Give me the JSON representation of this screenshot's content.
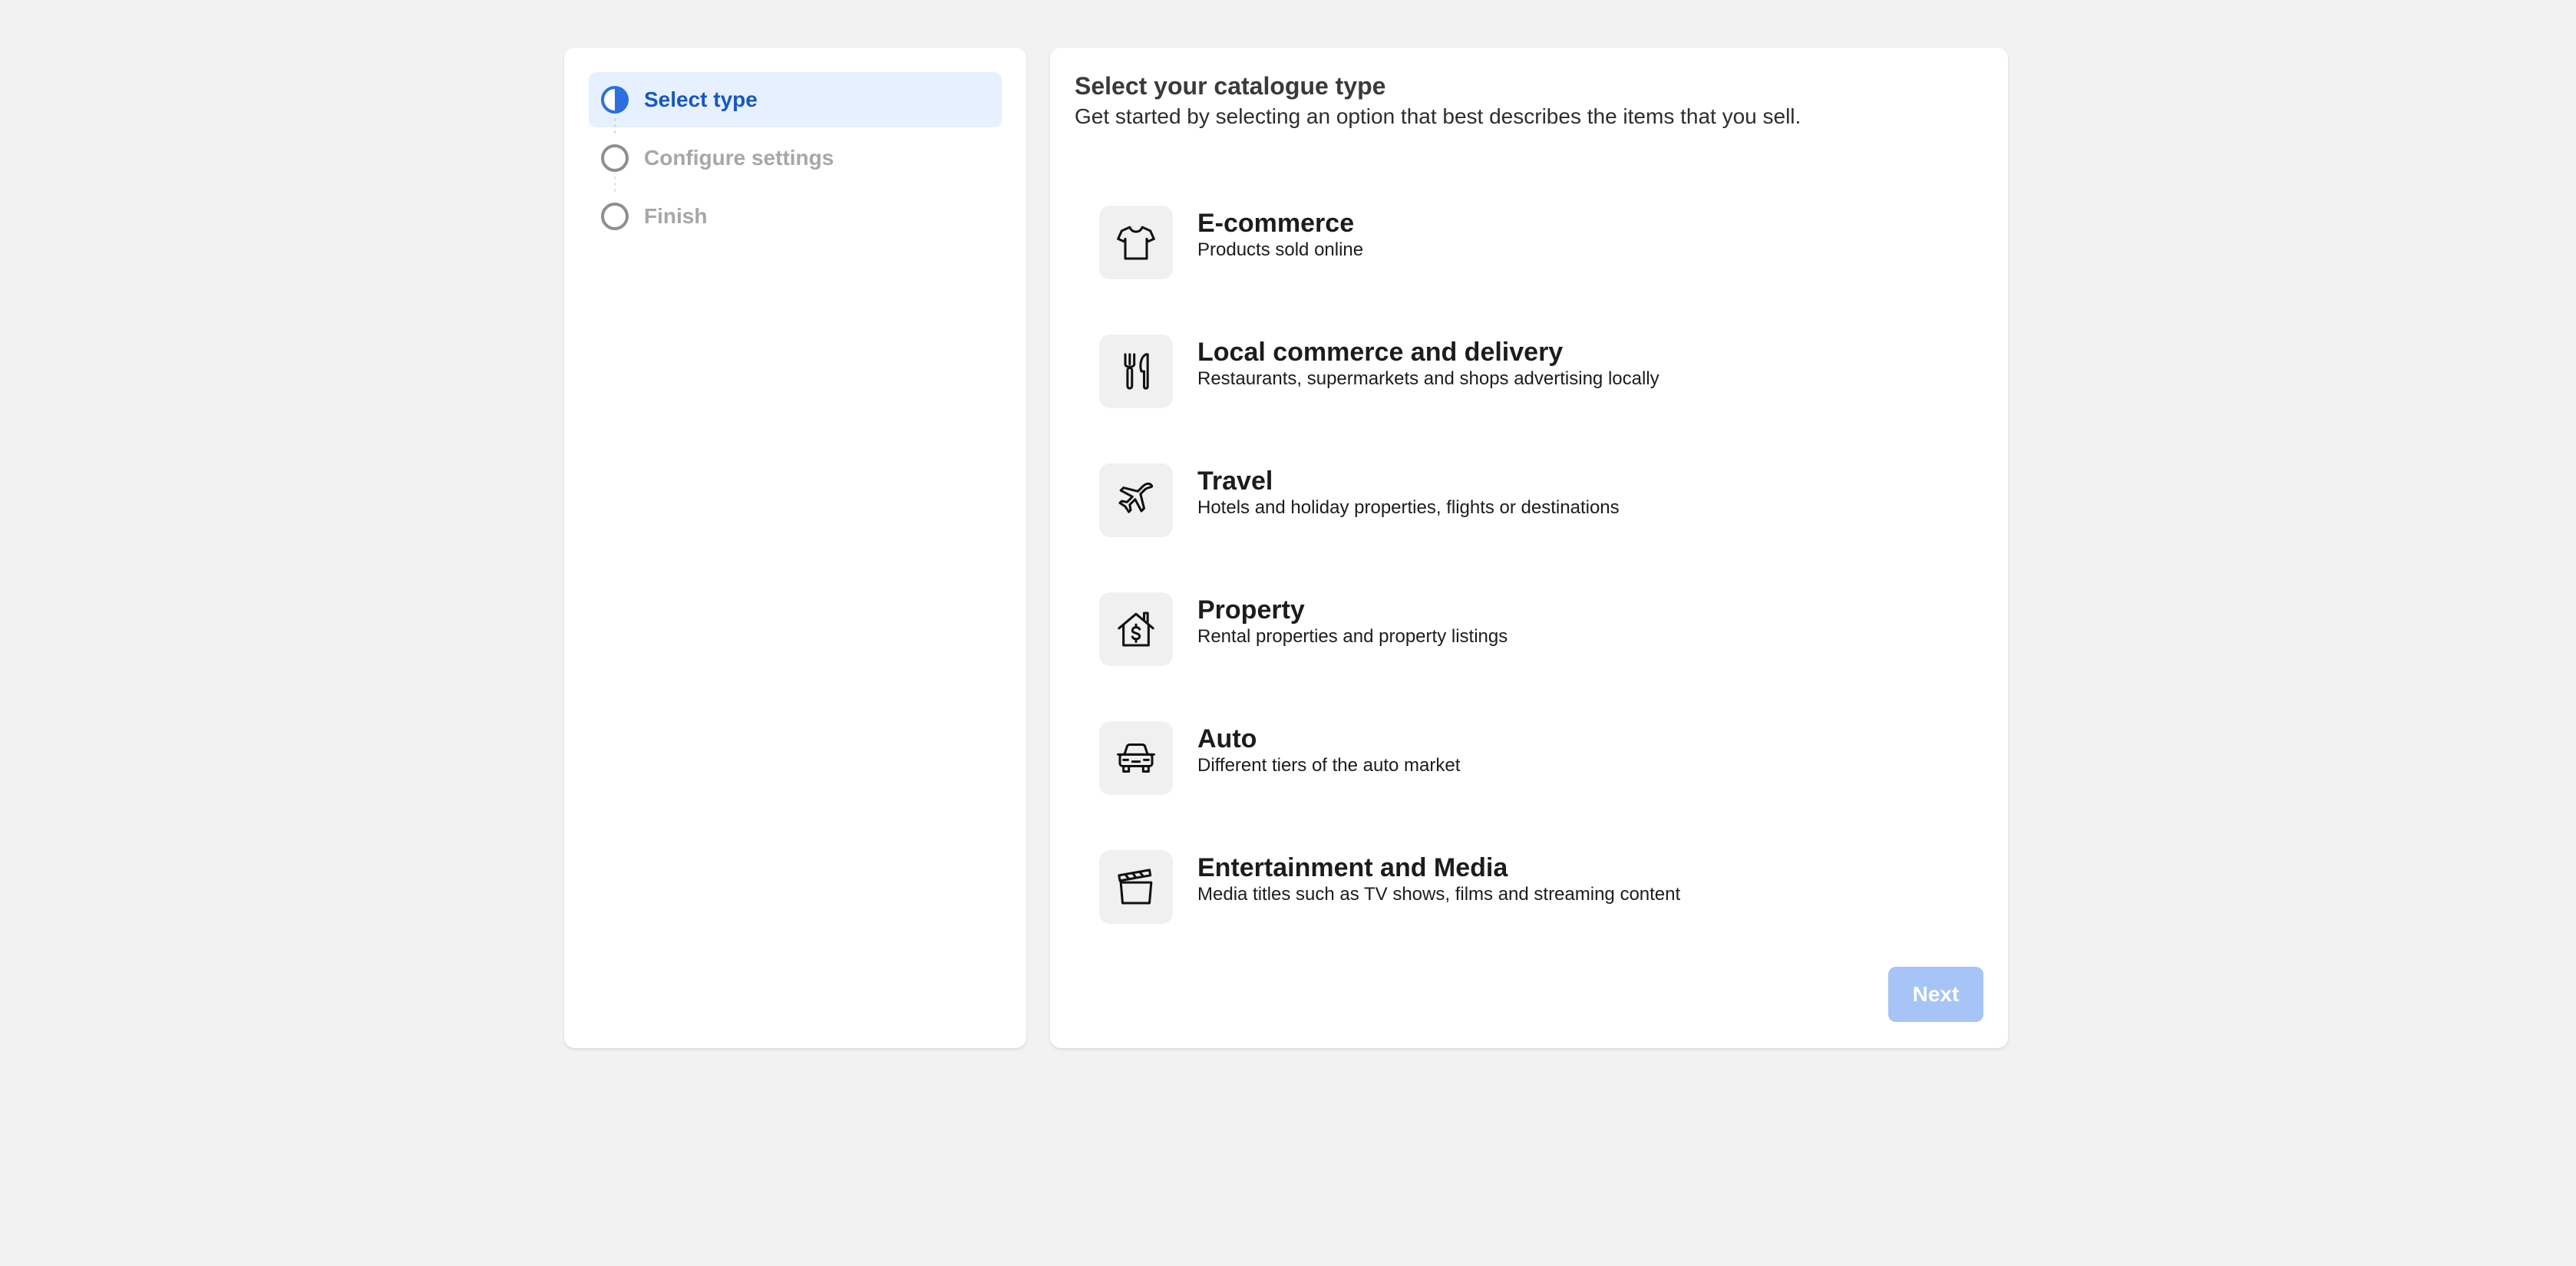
{
  "steps": [
    {
      "label": "Select type",
      "state": "active"
    },
    {
      "label": "Configure settings",
      "state": "pending"
    },
    {
      "label": "Finish",
      "state": "pending"
    }
  ],
  "main": {
    "title": "Select your catalogue type",
    "subtitle": "Get started by selecting an option that best describes the items that you sell."
  },
  "options": [
    {
      "title": "E-commerce",
      "description": "Products sold online",
      "icon": "t-shirt-icon"
    },
    {
      "title": "Local commerce and delivery",
      "description": "Restaurants, supermarkets and shops advertising locally",
      "icon": "fork-knife-icon"
    },
    {
      "title": "Travel",
      "description": "Hotels and holiday properties, flights or destinations",
      "icon": "airplane-icon"
    },
    {
      "title": "Property",
      "description": "Rental properties and property listings",
      "icon": "house-dollar-icon"
    },
    {
      "title": "Auto",
      "description": "Different tiers of the auto market",
      "icon": "car-icon"
    },
    {
      "title": "Entertainment and Media",
      "description": "Media titles such as TV shows, films and streaming content",
      "icon": "clapperboard-icon"
    }
  ],
  "footer": {
    "next_label": "Next"
  },
  "colors": {
    "accent": "#2c6fe0",
    "active_step_bg": "#e7f0fe",
    "disabled_button": "#a6c4f6",
    "page_bg": "#f2f2f2"
  }
}
